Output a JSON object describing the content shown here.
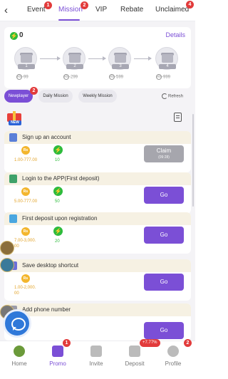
{
  "top_tabs": [
    {
      "label": "Event",
      "badge": "1"
    },
    {
      "label": "Mission",
      "badge": "2"
    },
    {
      "label": "VIP",
      "badge": ""
    },
    {
      "label": "Rebate",
      "badge": ""
    },
    {
      "label": "Unclaimed",
      "badge": "4"
    }
  ],
  "summary": {
    "count": "0",
    "details_label": "Details",
    "chests": [
      {
        "num": "1",
        "req": "-99"
      },
      {
        "num": "2",
        "req": "-299"
      },
      {
        "num": "3",
        "req": "-599"
      },
      {
        "num": "4",
        "req": "-999"
      }
    ],
    "coin_symbol": "₨"
  },
  "sub_tabs": [
    {
      "label": "Newplayer",
      "badge": "2"
    },
    {
      "label": "Daily Mission",
      "badge": ""
    },
    {
      "label": "Weekly Mission",
      "badge": ""
    }
  ],
  "refresh_label": "Refresh",
  "new_label": "NEW",
  "tasks": [
    {
      "title": "Sign up an account",
      "amount": "1.00-777.00",
      "points": "10",
      "button": "Claim",
      "button_sub": "(09:28)"
    },
    {
      "title": "Login to the APP(First deposit)",
      "amount": "5.00-777.00",
      "points": "50",
      "button": "Go",
      "button_sub": ""
    },
    {
      "title": "First deposit upon registration",
      "amount": "7.00-3,000.\n00",
      "points": "20",
      "button": "Go",
      "button_sub": ""
    },
    {
      "title": "Save desktop shortcut",
      "amount": "1.00-2,000.\n00",
      "points": "",
      "button": "Go",
      "button_sub": ""
    },
    {
      "title": "Add phone number",
      "amount": "",
      "points": "",
      "button": "Go",
      "button_sub": ""
    }
  ],
  "coin_icon_label": "Rs",
  "bolt_icon": "⚡",
  "bottom_nav": [
    {
      "label": "Home"
    },
    {
      "label": "Promo"
    },
    {
      "label": "Invite"
    },
    {
      "label": "Deposit"
    },
    {
      "label": "Profile"
    }
  ],
  "bottom_badges": {
    "promo": "1",
    "deposit": "+7.77%",
    "profile": "2"
  },
  "colors": {
    "accent": "#7b4fd6",
    "green": "#2dbb3c",
    "gold": "#f3b62e",
    "badge": "#e23b3b"
  }
}
